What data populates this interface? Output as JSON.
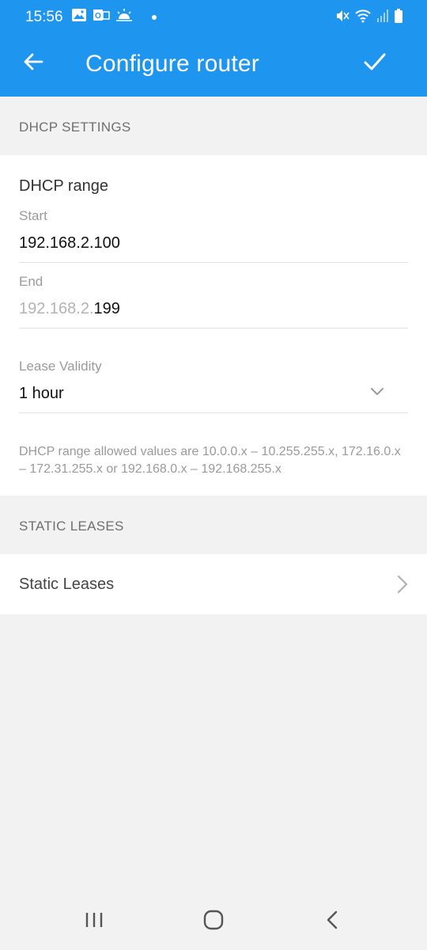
{
  "status_bar": {
    "time": "15:56",
    "left_icons": [
      "image-icon",
      "outlook-icon",
      "weather-icon",
      "dot-icon"
    ],
    "right_icons": [
      "mute-icon",
      "wifi-icon",
      "signal-icon",
      "battery-icon"
    ]
  },
  "app_bar": {
    "title": "Configure router",
    "back_icon": "arrow-left-icon",
    "confirm_icon": "check-icon"
  },
  "dhcp_section": {
    "header": "DHCP SETTINGS",
    "range_title": "DHCP range",
    "start": {
      "label": "Start",
      "value": "192.168.2.100"
    },
    "end": {
      "label": "End",
      "prefix": "192.168.2.",
      "value": "199"
    },
    "lease": {
      "label": "Lease Validity",
      "value": "1 hour"
    },
    "help_text": "DHCP range allowed values are 10.0.0.x – 10.255.255.x, 172.16.0.x – 172.31.255.x or 192.168.0.x – 192.168.255.x"
  },
  "static_section": {
    "header": "STATIC LEASES",
    "row_label": "Static Leases"
  },
  "nav_bar": {
    "buttons": [
      "recent-apps-icon",
      "home-icon",
      "back-icon"
    ]
  },
  "colors": {
    "primary": "#1e96f0",
    "background": "#f2f2f2",
    "card": "#ffffff",
    "muted_text": "#9a9a9a"
  }
}
